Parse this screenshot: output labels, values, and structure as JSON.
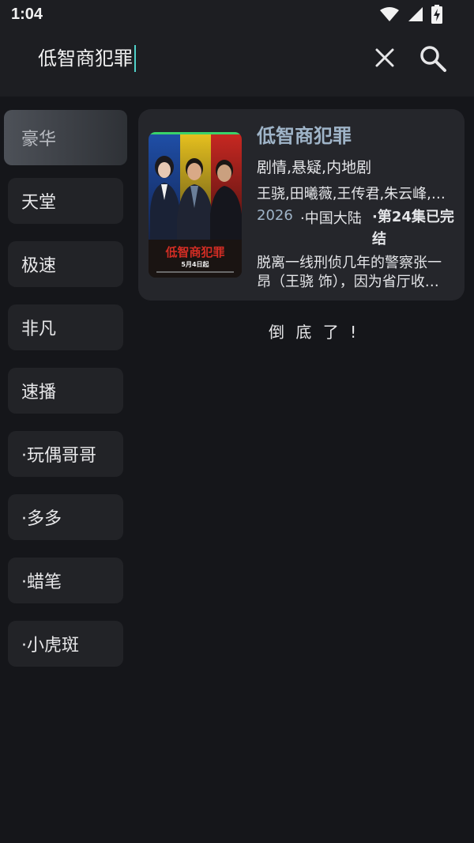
{
  "status_bar": {
    "time": "1:04",
    "icons": [
      "wifi-icon",
      "signal-icon",
      "battery-charging-icon"
    ]
  },
  "search": {
    "query": "低智商犯罪",
    "clear_icon": "close-icon",
    "search_icon": "search-icon"
  },
  "sources": [
    {
      "label": "豪华",
      "active": true
    },
    {
      "label": "天堂",
      "active": false
    },
    {
      "label": "极速",
      "active": false
    },
    {
      "label": "非凡",
      "active": false
    },
    {
      "label": "速播",
      "active": false
    },
    {
      "label": "·玩偶哥哥",
      "active": false
    },
    {
      "label": "·多多",
      "active": false
    },
    {
      "label": "·蜡笔",
      "active": false
    },
    {
      "label": "·小虎斑",
      "active": false
    }
  ],
  "result": {
    "poster_title": "低智商犯罪",
    "poster_date": "5月4日起",
    "title": "低智商犯罪",
    "genre": "剧情,悬疑,内地剧",
    "cast": "王骁,田曦薇,王传君,朱云峰,张…",
    "year": "2026",
    "region": "·中国大陆",
    "status": "·第24集已完结",
    "description": "脱离一线刑侦几年的警察张一昂（王骁 饰），因为省厅收…"
  },
  "end_text": "倒 底 了 !",
  "colors": {
    "background": "#15161a",
    "header": "#1d1e22",
    "card": "#25262b",
    "accent_title": "#9fb4c8",
    "cursor": "#4fd0c8"
  }
}
